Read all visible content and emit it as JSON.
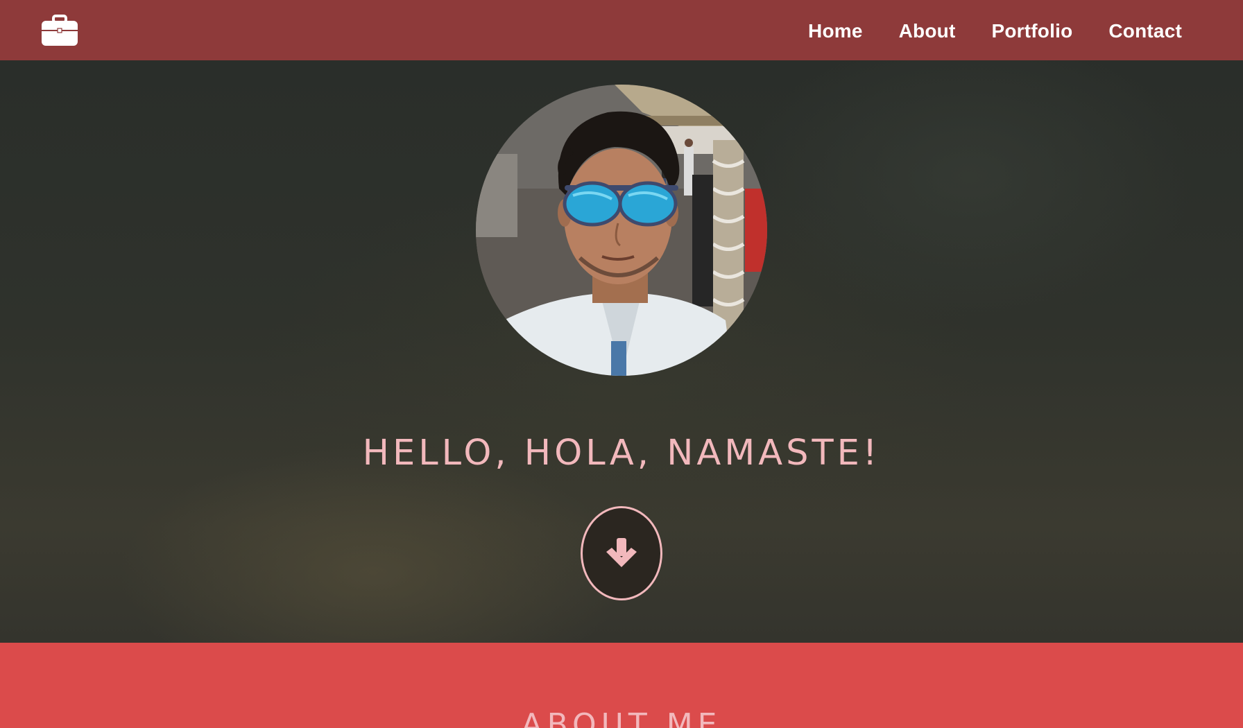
{
  "nav": {
    "logo_icon": "briefcase-icon",
    "links": [
      "Home",
      "About",
      "Portfolio",
      "Contact"
    ]
  },
  "hero": {
    "avatar_alt": "profile-photo",
    "greeting": "HELLO, HOLA, NAMASTE!",
    "scroll_icon": "arrow-down-icon"
  },
  "about": {
    "heading": "ABOUT ME"
  },
  "colors": {
    "navbar": "#8e3a3a",
    "hero_bg": "#2f3129",
    "accent_pink": "#f2b8bc",
    "about_bg": "#db4b4b",
    "white": "#ffffff"
  }
}
